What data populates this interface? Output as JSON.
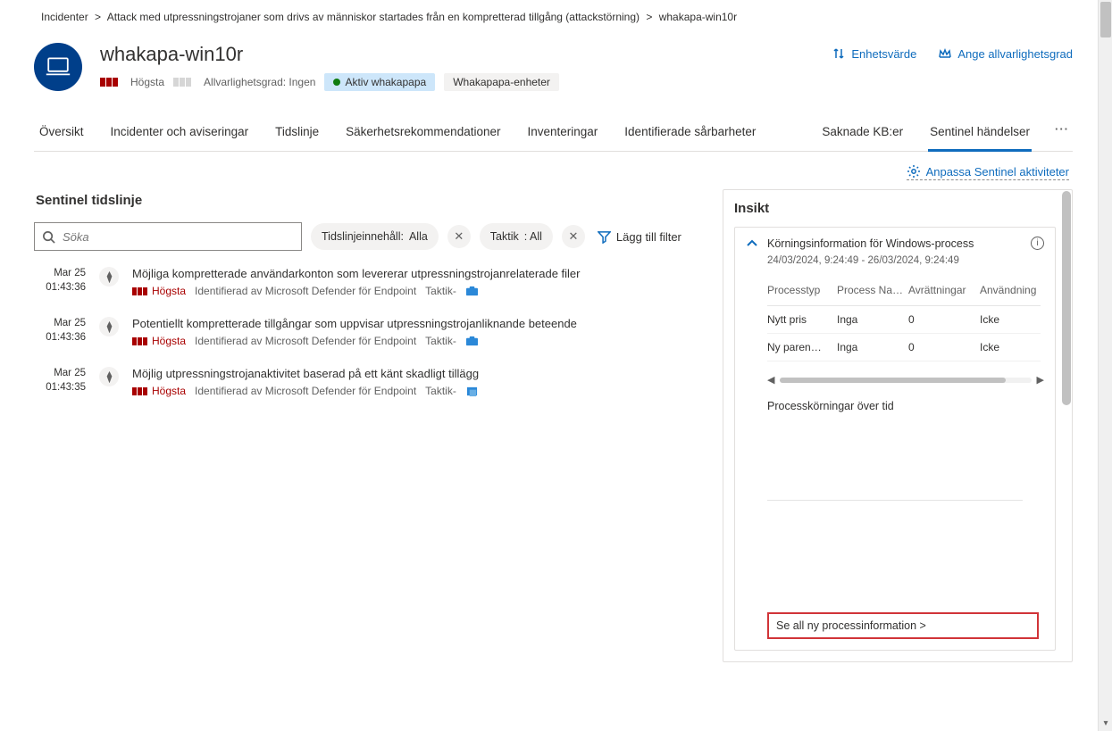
{
  "breadcrumb": {
    "part1": "Incidenter",
    "part2": "Attack med utpressningstrojaner som drivs av människor startades från en kompretterad tillgång (attackstörning)",
    "part3": "whakapa-win10r",
    "sep": "&gt;"
  },
  "device": {
    "title": "whakapa-win10r",
    "criticality": "Högsta",
    "severity_label": "Allvarlighetsgrad:",
    "severity_value": "Ingen",
    "user_chip": "Aktiv whakapapa",
    "group_chip": "Whakapapa-enheter"
  },
  "headerActions": {
    "deviceValue": "Enhetsvärde",
    "setSeverity": "Ange allvarlighetsgrad"
  },
  "tabs": {
    "overview": "Översikt",
    "incidents": "Incidenter och aviseringar",
    "timeline": "Tidslinje",
    "recs": "Säkerhetsrekommendationer",
    "inventory": "Inventeringar",
    "vulns": "Identifierade sårbarheter",
    "missingKb": "Saknade KB:er",
    "sentinel": "Sentinel händelser",
    "more": "···"
  },
  "commandBar": {
    "customize": "Anpassa Sentinel aktiviteter"
  },
  "sentinel": {
    "title": "Sentinel tidslinje",
    "searchPlaceholder": "Söka",
    "filters": {
      "contentLabel": "Tidslinjeinnehåll:",
      "contentValue": "Alla",
      "tacticLabel": "Taktik",
      "tacticValue": ": All",
      "addFilter": "Lägg till filter"
    }
  },
  "timeline": [
    {
      "date": "Mar 25",
      "time": "01:43:36",
      "title": "Möjliga kompretterade användarkonton som levererar utpressningstrojanrelaterade filer",
      "sevLabel": "Högsta",
      "source": "Identifierad av Microsoft Defender för Endpoint",
      "tactic": "Taktik-"
    },
    {
      "date": "Mar 25",
      "time": "01:43:36",
      "title": "Potentiellt kompretterade tillgångar som uppvisar utpressningstrojanliknande beteende",
      "sevLabel": "Högsta",
      "source": "Identifierad av Microsoft Defender för Endpoint",
      "tactic": "Taktik-"
    },
    {
      "date": "Mar 25",
      "time": "01:43:35",
      "title": "Möjlig utpressningstrojanaktivitet baserad på ett känt skadligt tillägg",
      "sevLabel": "Högsta",
      "source": "Identifierad av Microsoft Defender för Endpoint",
      "tactic": "Taktik-"
    }
  ],
  "insight": {
    "title": "Insikt",
    "card": {
      "title": "Körningsinformation för Windows-process",
      "range": "24/03/2024, 9:24:49 - 26/03/2024, 9:24:49",
      "columns": {
        "c1": "Processtyp",
        "c2": "Process Na…",
        "c3": "Avrättningar",
        "c4": "Användning"
      },
      "rows": [
        {
          "c1": "Nytt pris",
          "c2": "Inga",
          "c3": "0",
          "c4": "Icke"
        },
        {
          "c1": "Ny paren…",
          "c2": "Inga",
          "c3": "0",
          "c4": "Icke"
        }
      ],
      "chartLabel": "Processkörningar över tid",
      "viewAll": "Se all ny processinformation &gt;"
    }
  }
}
